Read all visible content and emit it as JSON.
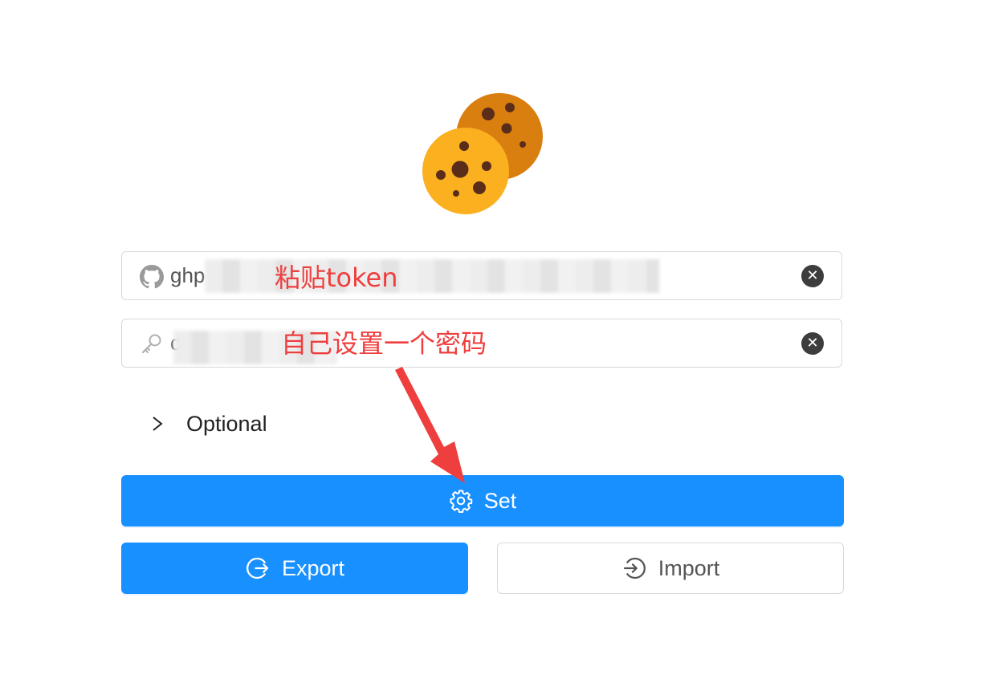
{
  "token_field": {
    "value": "ghp",
    "annotation": "粘贴token"
  },
  "password_field": {
    "value": "c",
    "annotation": "自己设置一个密码"
  },
  "optional": {
    "label": "Optional"
  },
  "buttons": {
    "set_label": "Set",
    "export_label": "Export",
    "import_label": "Import"
  },
  "colors": {
    "primary": "#1890ff",
    "annotation": "#ef3e3e",
    "cookie_front": "#fbb01f",
    "cookie_back": "#d97f10",
    "chocolate": "#5a2c1a"
  },
  "icons": {
    "logo": "cookies-icon",
    "token": "github-icon",
    "password": "key-icon",
    "clear": "close-circle-icon",
    "optional": "chevron-right-icon",
    "set": "gear-icon",
    "export": "export-icon",
    "import": "import-icon"
  }
}
